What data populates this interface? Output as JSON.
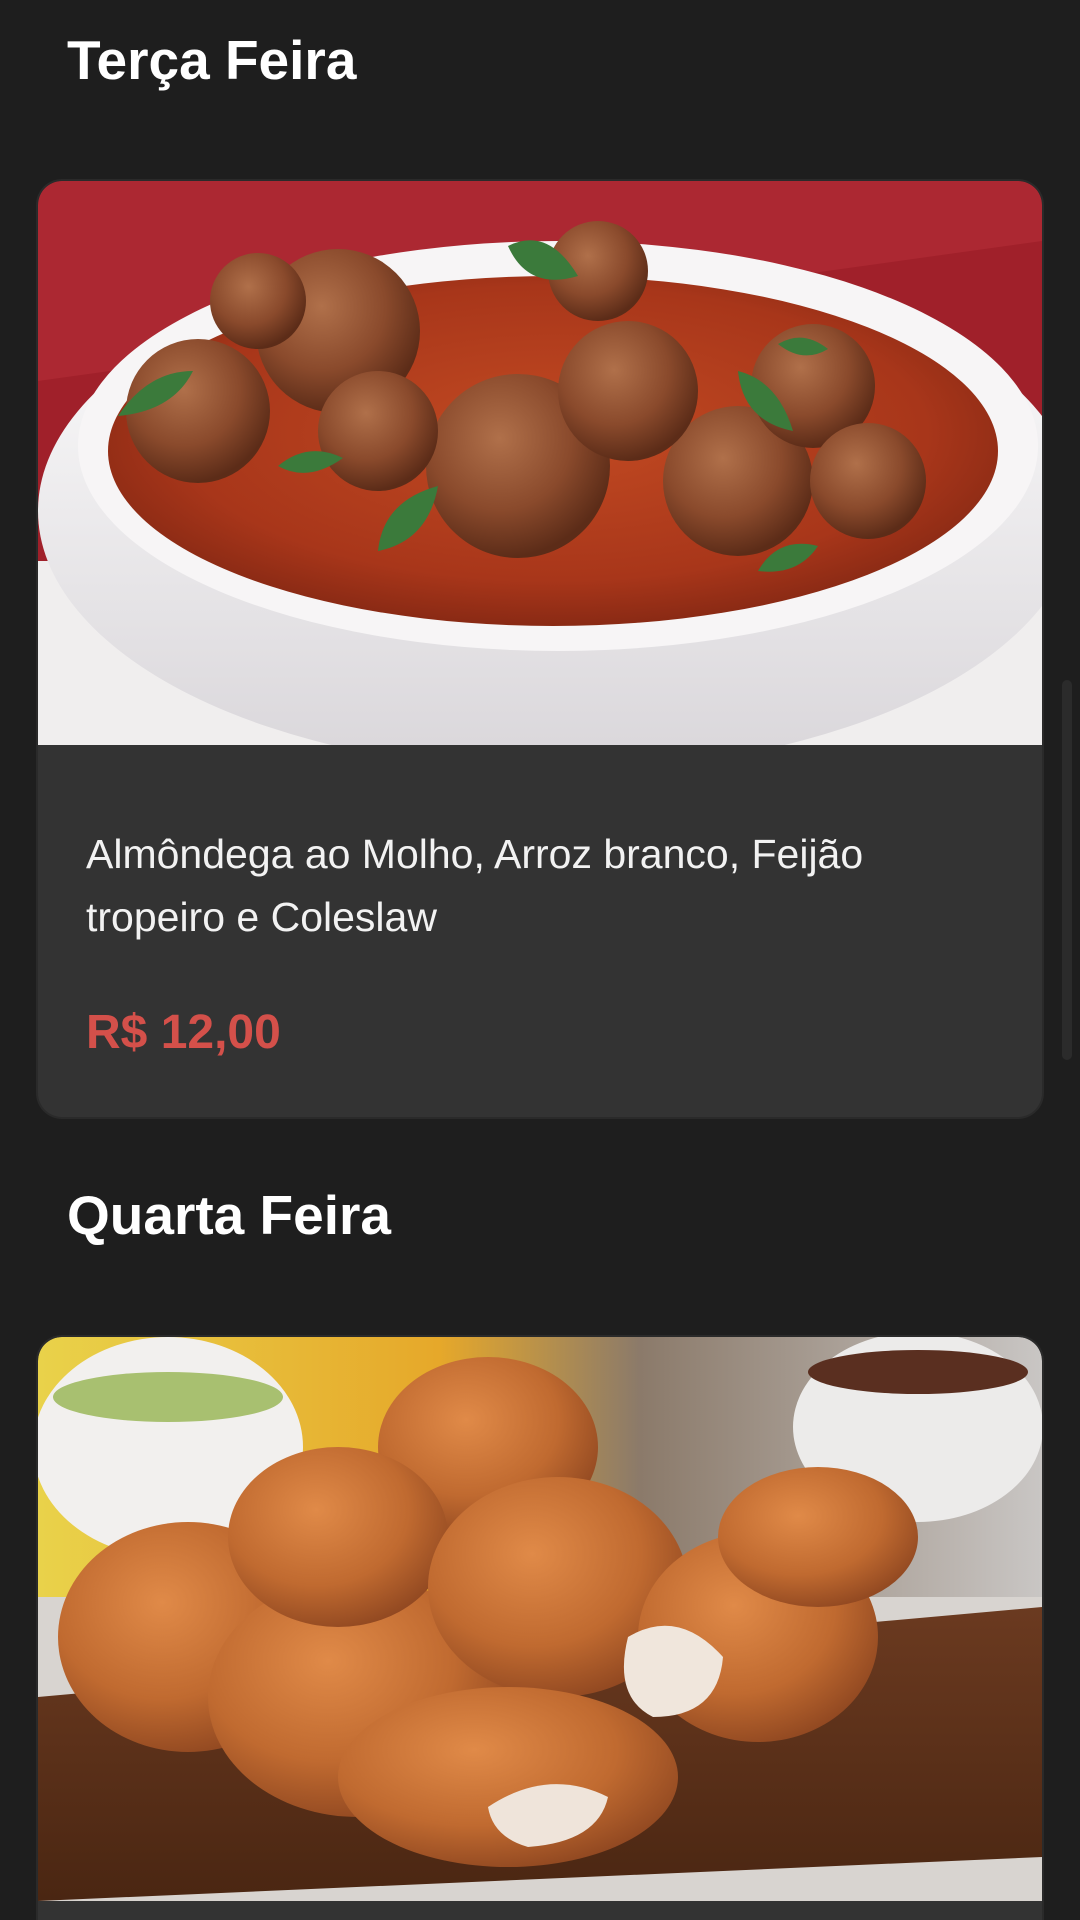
{
  "menu": [
    {
      "day": "Terça Feira",
      "description": "Almôndega ao Molho, Arroz branco, Feijão tropeiro e Coleslaw",
      "price": "R$ 12,00",
      "photo": "meatballs-in-tomato-sauce"
    },
    {
      "day": "Quarta Feira",
      "photo": "fried-chicken-on-board"
    }
  ],
  "colors": {
    "background": "#1e1e1e",
    "card": "#333333",
    "price": "#d4504a",
    "title": "#ffffff"
  }
}
